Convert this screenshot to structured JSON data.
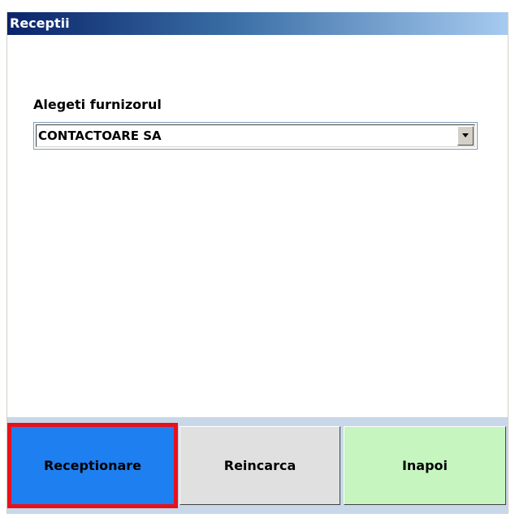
{
  "window": {
    "title": "Receptii"
  },
  "form": {
    "supplier_label": "Alegeti furnizorul",
    "supplier_value": "CONTACTOARE SA"
  },
  "buttons": {
    "receive_label": "Receptionare",
    "reload_label": "Reincarca",
    "back_label": "Inapoi"
  },
  "colors": {
    "titlebar_start": "#0a246a",
    "titlebar_end": "#a6caf0",
    "receive_button": "#1e7ff0",
    "reload_button": "#e0e0e0",
    "back_button": "#c6f5c0",
    "highlight": "#e30613",
    "button_bar": "#c8d8e8"
  }
}
